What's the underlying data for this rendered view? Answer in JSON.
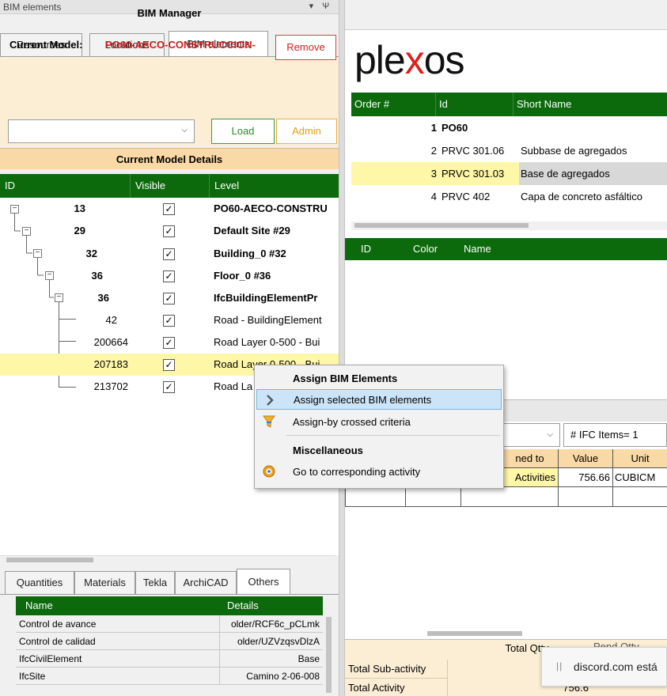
{
  "panel": {
    "title": "BIM elements",
    "controls": "▾ Ѱ"
  },
  "tabs": [
    "Resources",
    "Locations",
    "BIM elements"
  ],
  "bim_manager": {
    "title": "BIM Manager",
    "current_model_label": "Current Model:",
    "current_model_value": "PO60-AECO-CONSTRUCCION-",
    "remove_label": "Remove",
    "select_value": "",
    "load_label": "Load",
    "admin_label": "Admin"
  },
  "current_model_details": {
    "title": "Current Model Details",
    "columns": [
      "ID",
      "Visible",
      "Level"
    ],
    "rows": [
      {
        "id": "13",
        "visible": "✓",
        "level": "PO60-AECO-CONSTRU",
        "bold": true
      },
      {
        "id": "29",
        "visible": "✓",
        "level": "Default Site #29",
        "bold": true
      },
      {
        "id": "32",
        "visible": "✓",
        "level": "Building_0 #32",
        "bold": true
      },
      {
        "id": "36",
        "visible": "✓",
        "level": "Floor_0 #36",
        "bold": true
      },
      {
        "id": "36",
        "visible": "✓",
        "level": "IfcBuildingElementPr",
        "bold": true
      },
      {
        "id": "42",
        "visible": "✓",
        "level": "Road - BuildingElement",
        "bold": false
      },
      {
        "id": "200664",
        "visible": "✓",
        "level": "Road Layer 0-500 - Bui",
        "bold": false
      },
      {
        "id": "207183",
        "visible": "✓",
        "level": "Road Layer 0-500 - Bui",
        "bold": false
      },
      {
        "id": "213702",
        "visible": "✓",
        "level": "Road La",
        "bold": false
      }
    ]
  },
  "bottom_tabs": [
    "Quantities",
    "Materials",
    "Tekla",
    "ArchiCAD",
    "Others"
  ],
  "others": {
    "columns": [
      "Name",
      "Details"
    ],
    "rows": [
      {
        "name": "Control de avance",
        "details": "older/RCF6c_pCLmk"
      },
      {
        "name": "Control de calidad",
        "details": "older/UZVzqsvDlzA"
      },
      {
        "name": "IfcCivilElement",
        "details": "Base"
      },
      {
        "name": "IfcSite",
        "details": "Camino 2-06-008"
      }
    ]
  },
  "logo": {
    "pre": "ple",
    "x": "x",
    "post": "os"
  },
  "order_table": {
    "columns": [
      "Order #",
      "Id",
      "Short Name"
    ],
    "rows": [
      {
        "order": "1",
        "id": "PO60",
        "short": "",
        "bold": true
      },
      {
        "order": "2",
        "id": "PRVC 301.06",
        "short": "Subbase de agregados",
        "bold": false
      },
      {
        "order": "3",
        "id": "PRVC 301.03",
        "short": "Base de agregados",
        "bold": false
      },
      {
        "order": "4",
        "id": "PRVC 402",
        "short": "Capa de concreto asfáltico",
        "bold": false
      }
    ]
  },
  "color_table": {
    "columns": [
      "ID",
      "Color",
      "Name"
    ]
  },
  "ifc": {
    "select_value": "",
    "count_label": "# IFC Items= 1"
  },
  "assign_table": {
    "columns": [
      "ned to",
      "Value",
      "Unit"
    ],
    "row": {
      "assigned": "Activities",
      "value": "756.66",
      "unit": "CUBICM"
    }
  },
  "totals": {
    "total_qtty_label": "Total Qtty",
    "pend_qtty_label": "Pend Qtty",
    "sub_activity_label": "Total Sub-activity",
    "activity_label": "Total Activity",
    "activity_value": "756.6"
  },
  "toast": {
    "pause_icon": "||",
    "text": "discord.com está"
  },
  "context_menu": {
    "header1": "Assign BIM Elements",
    "item1": "Assign selected BIM elements",
    "item2": "Assign-by crossed criteria",
    "header2": "Miscellaneous",
    "item3": "Go to corresponding activity"
  },
  "colors": {
    "header_green": "#0c6a0c",
    "accent_red": "#cc1a1a",
    "selected_row": "#fff7a8",
    "peach": "#fbeed5",
    "menu_highlight": "#cce4f7"
  }
}
